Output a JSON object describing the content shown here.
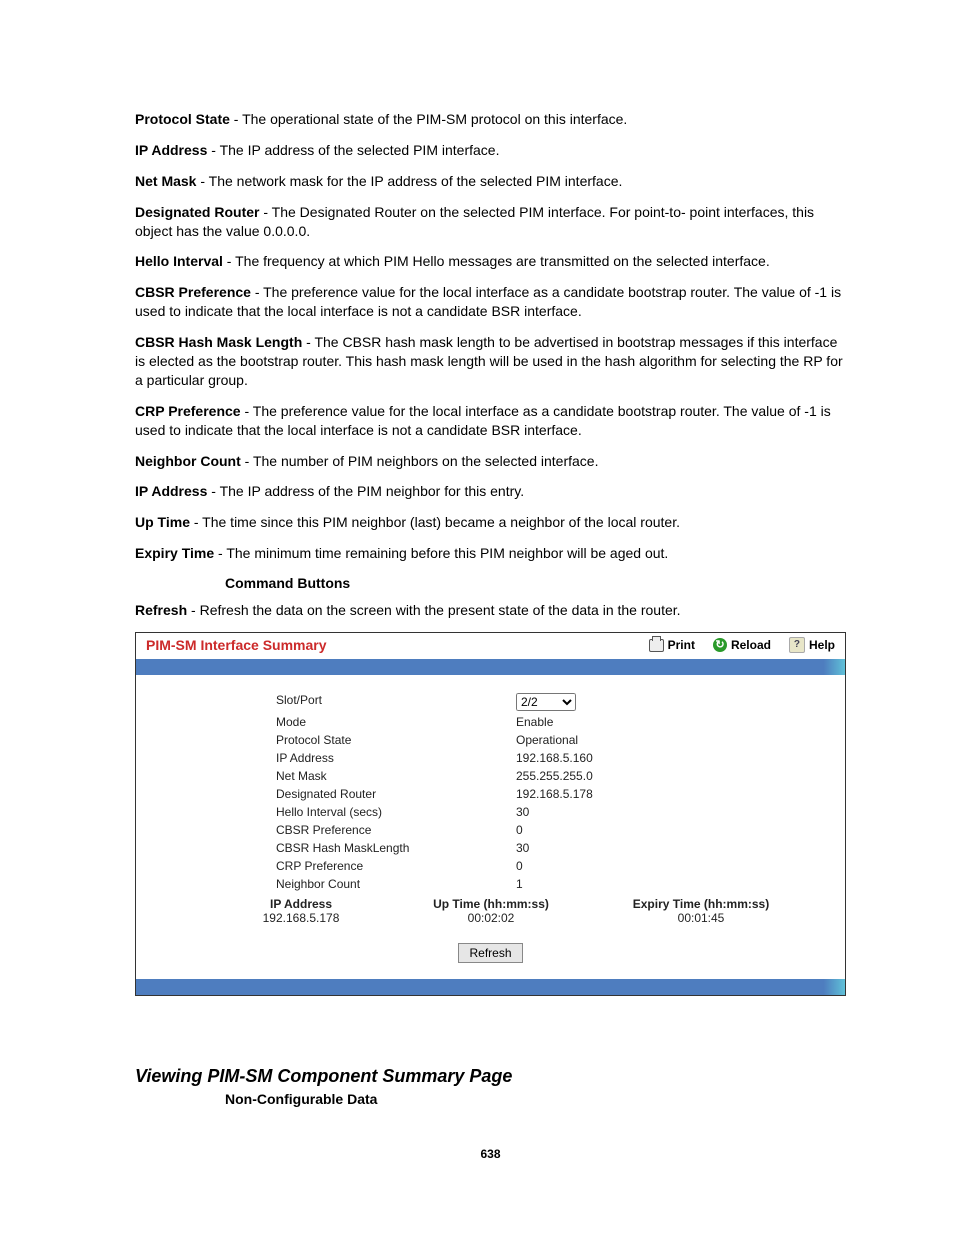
{
  "definitions": [
    {
      "term": "Protocol State",
      "desc": " - The operational state of the PIM-SM protocol on this interface."
    },
    {
      "term": "IP Address",
      "desc": " - The IP address of the selected PIM interface."
    },
    {
      "term": "Net Mask",
      "desc": " - The network mask for the IP address of the selected PIM interface."
    },
    {
      "term": "Designated Router",
      "desc": " - The Designated Router on the selected PIM interface. For point-to- point interfaces, this object has the value 0.0.0.0."
    },
    {
      "term": "Hello Interval",
      "desc": " - The frequency at which PIM Hello messages are transmitted on the selected interface."
    },
    {
      "term": "CBSR Preference",
      "desc": " - The preference value for the local interface as a candidate bootstrap router. The value of -1 is used to indicate that the local interface is not a candidate BSR interface."
    },
    {
      "term": "CBSR Hash Mask Length",
      "desc": " - The CBSR hash mask length to be advertised in bootstrap messages if this interface is elected as the bootstrap router. This hash mask length will be used in the hash algorithm for selecting the RP for a particular group."
    },
    {
      "term": "CRP Preference",
      "desc": " - The preference value for the local interface as a candidate bootstrap router. The value of -1 is used to indicate that the local interface is not a candidate BSR interface."
    },
    {
      "term": "Neighbor Count",
      "desc": " - The number of PIM neighbors on the selected interface."
    },
    {
      "term": "IP Address",
      "desc": " - The IP address of the PIM neighbor for this entry."
    },
    {
      "term": "Up Time",
      "desc": " - The time since this PIM neighbor (last) became a neighbor of the local router."
    },
    {
      "term": "Expiry Time",
      "desc": " - The minimum time remaining before this PIM neighbor will be aged out."
    }
  ],
  "commandButtonsHeading": "Command Buttons",
  "refreshDef": {
    "term": "Refresh",
    "desc": " - Refresh the data on the screen with the present state of the data in the router."
  },
  "panel": {
    "title": "PIM-SM Interface Summary",
    "actions": {
      "print": "Print",
      "reload": "Reload",
      "help": "Help"
    },
    "fields": {
      "slotPort": {
        "label": "Slot/Port",
        "value": "2/2"
      },
      "mode": {
        "label": "Mode",
        "value": "Enable"
      },
      "protocolState": {
        "label": "Protocol State",
        "value": "Operational"
      },
      "ipAddress": {
        "label": "IP Address",
        "value": "192.168.5.160"
      },
      "netMask": {
        "label": "Net Mask",
        "value": "255.255.255.0"
      },
      "designatedRouter": {
        "label": "Designated Router",
        "value": "192.168.5.178"
      },
      "helloInterval": {
        "label": "Hello Interval (secs)",
        "value": "30"
      },
      "cbsrPref": {
        "label": "CBSR Preference",
        "value": "0"
      },
      "cbsrHash": {
        "label": "CBSR Hash MaskLength",
        "value": "30"
      },
      "crpPref": {
        "label": "CRP Preference",
        "value": "0"
      },
      "neighborCount": {
        "label": "Neighbor Count",
        "value": "1"
      }
    },
    "neighborHeaders": {
      "ip": "IP Address",
      "up": "Up Time (hh:mm:ss)",
      "exp": "Expiry Time (hh:mm:ss)"
    },
    "neighborRow": {
      "ip": "192.168.5.178",
      "up": "00:02:02",
      "exp": "00:01:45"
    },
    "refreshLabel": "Refresh"
  },
  "nextSection": {
    "title": "Viewing PIM-SM Component Summary Page",
    "sub": "Non-Configurable Data"
  },
  "pageNumber": "638"
}
